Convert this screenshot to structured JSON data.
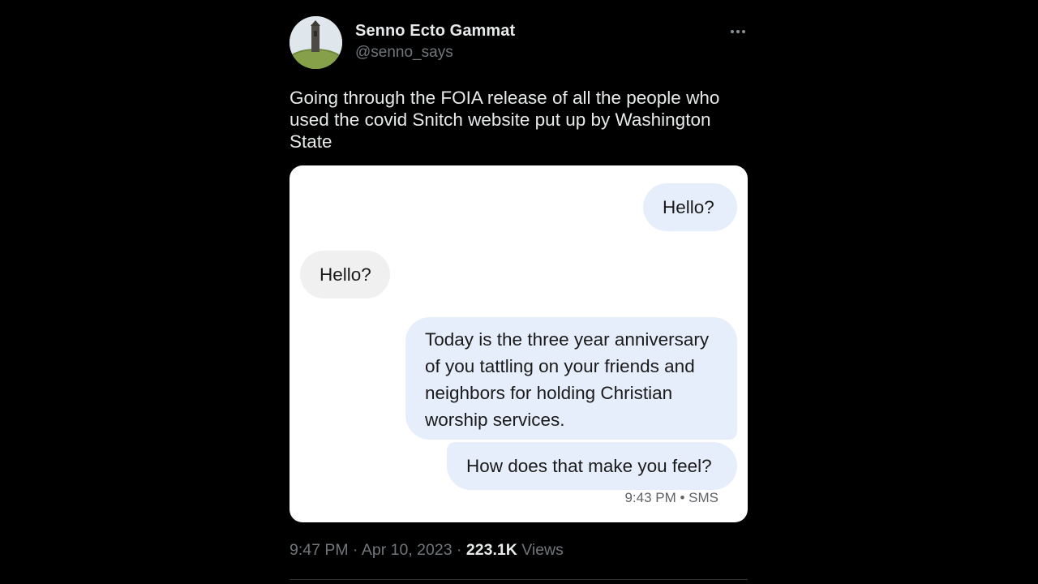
{
  "author": {
    "name": "Senno Ecto Gammat",
    "handle": "@senno_says"
  },
  "tweet": {
    "text": "Going through the FOIA release of all the people who used the covid Snitch website put up by Washington State"
  },
  "media": {
    "messages": [
      {
        "direction": "outgoing",
        "text": "Hello?"
      },
      {
        "direction": "incoming",
        "text": "Hello?"
      },
      {
        "direction": "outgoing",
        "text": "Today is the three year anniversary of you tattling on your friends and neighbors for holding Christian worship services."
      },
      {
        "direction": "outgoing",
        "text": "How does that make you feel?"
      }
    ],
    "meta": "9:43 PM • SMS"
  },
  "footer": {
    "time": "9:47 PM",
    "date": "Apr 10, 2023",
    "views_count": "223.1K",
    "views_label": "Views"
  },
  "colors": {
    "background": "#000000",
    "primary_text": "#e7e9ea",
    "secondary_text": "#71767b",
    "outgoing_bubble": "#e7eefb",
    "incoming_bubble": "#f0f0f0"
  }
}
